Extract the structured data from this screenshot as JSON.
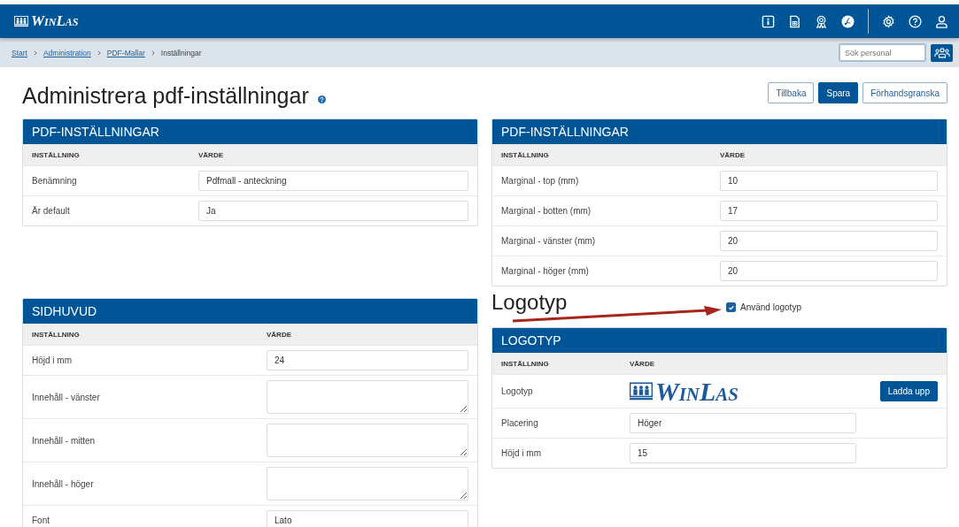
{
  "app": {
    "logo": "WinLas"
  },
  "breadcrumbs": [
    {
      "label": "Start",
      "link": true
    },
    {
      "label": "Administration",
      "link": true
    },
    {
      "label": "PDF-Mallar",
      "link": true
    },
    {
      "label": "Inställningar",
      "link": false
    }
  ],
  "search": {
    "placeholder": "Sök personal"
  },
  "page": {
    "title": "Administrera pdf-inställningar"
  },
  "actions": [
    {
      "label": "Tillbaka",
      "primary": false
    },
    {
      "label": "Spara",
      "primary": true
    },
    {
      "label": "Förhandsgranska",
      "primary": false
    }
  ],
  "left_panels": [
    {
      "title": "PDF-INSTÄLLNINGAR",
      "columns": [
        "INSTÄLLNING",
        "VÄRDE"
      ],
      "rows": [
        {
          "label": "Benämning",
          "kind": "input",
          "value": "Pdfmall - anteckning"
        },
        {
          "label": "Är default",
          "kind": "input",
          "value": "Ja"
        }
      ]
    },
    {
      "title": "SIDHUVUD",
      "columns": [
        "INSTÄLLNING",
        "VÄRDE"
      ],
      "rows": [
        {
          "label": "Höjd i mm",
          "kind": "input",
          "value": "24"
        },
        {
          "label": "Innehåll - vänster",
          "kind": "textarea"
        },
        {
          "label": "Innehåll - mitten",
          "kind": "textarea"
        },
        {
          "label": "Innehåll - höger",
          "kind": "textarea"
        },
        {
          "label": "Font",
          "kind": "input",
          "value": "Lato"
        }
      ]
    }
  ],
  "right_panel": {
    "title": "PDF-INSTÄLLNINGAR",
    "columns": [
      "INSTÄLLNING",
      "VÄRDE"
    ],
    "rows": [
      {
        "label": "Marginal - top (mm)",
        "kind": "input",
        "value": "10"
      },
      {
        "label": "Marginal - botten (mm)",
        "kind": "input",
        "value": "17"
      },
      {
        "label": "Marginal - vänster (mm)",
        "kind": "input",
        "value": "20"
      },
      {
        "label": "Marginal - höger (mm)",
        "kind": "input",
        "value": "20"
      }
    ]
  },
  "logo_section": {
    "heading": "Logotyp",
    "use_logo": {
      "label": "Använd logotyp",
      "checked": true
    },
    "panel": {
      "title": "LOGOTYP",
      "columns": [
        "INSTÄLLNING",
        "VÄRDE"
      ],
      "rows": [
        {
          "label": "Logotyp",
          "kind": "logo",
          "logo_text": "WinLas",
          "button": "Ladda upp"
        },
        {
          "label": "Placering",
          "kind": "input",
          "value": "Höger"
        },
        {
          "label": "Höjd i mm",
          "kind": "input",
          "value": "15"
        }
      ]
    }
  }
}
